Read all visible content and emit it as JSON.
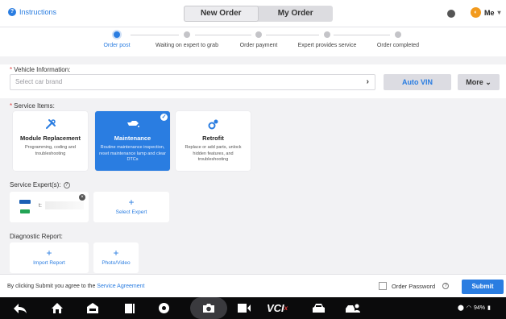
{
  "topbar": {
    "instructions_label": "Instructions",
    "tabs": [
      {
        "label": "New Order",
        "active": true
      },
      {
        "label": "My Order",
        "active": false
      }
    ],
    "user_label": "Me"
  },
  "steps": [
    {
      "label": "Order post",
      "active": true
    },
    {
      "label": "Waiting on expert to grab",
      "active": false
    },
    {
      "label": "Order payment",
      "active": false
    },
    {
      "label": "Expert provides service",
      "active": false
    },
    {
      "label": "Order completed",
      "active": false
    }
  ],
  "vehicle": {
    "label": "Vehicle Information:",
    "placeholder": "Select car brand",
    "auto_vin_label": "Auto VIN",
    "more_label": "More"
  },
  "service": {
    "label": "Service Items:",
    "items": [
      {
        "title": "Module Replacement",
        "desc": "Programming, coding and troubleshooting",
        "selected": false,
        "icon": "tools-icon"
      },
      {
        "title": "Maintenance",
        "desc": "Routine maintenance inspection, reset maintenance lamp and clear DTCs",
        "selected": true,
        "icon": "oil-can-icon"
      },
      {
        "title": "Retrofit",
        "desc": "Replace or add parts, unlock hidden features, and troubleshooting",
        "selected": false,
        "icon": "gears-icon"
      }
    ]
  },
  "experts": {
    "label": "Service Expert(s):",
    "expert_name": "t:",
    "select_label": "Select Expert"
  },
  "report": {
    "label": "Diagnostic Report:",
    "import_label": "Import Report",
    "photo_label": "Photo/Video"
  },
  "footer": {
    "agree_text": "By clicking Submit you agree to the ",
    "agree_link": "Service Agreement",
    "password_label": "Order Password",
    "submit_label": "Submit"
  },
  "navbar": {
    "vci_label": "VCI",
    "battery": "94%"
  },
  "colors": {
    "accent": "#2a7de1",
    "background": "#f2f2f4",
    "navbar": "#0b0b0c"
  }
}
